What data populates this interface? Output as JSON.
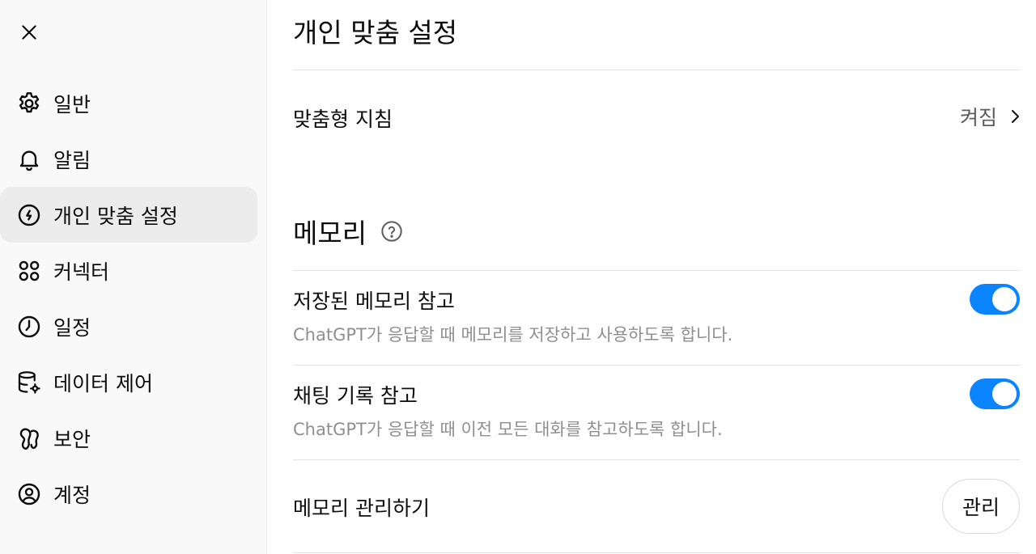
{
  "sidebar": {
    "close_icon": "close-icon",
    "items": [
      {
        "label": "일반",
        "icon": "gear-icon",
        "active": false
      },
      {
        "label": "알림",
        "icon": "bell-icon",
        "active": false
      },
      {
        "label": "개인 맞춤 설정",
        "icon": "personalization-icon",
        "active": true
      },
      {
        "label": "커넥터",
        "icon": "connectors-icon",
        "active": false
      },
      {
        "label": "일정",
        "icon": "clock-icon",
        "active": false
      },
      {
        "label": "데이터 제어",
        "icon": "database-gear-icon",
        "active": false
      },
      {
        "label": "보안",
        "icon": "security-icon",
        "active": false
      },
      {
        "label": "계정",
        "icon": "user-circle-icon",
        "active": false
      }
    ]
  },
  "main": {
    "title": "개인 맞춤 설정",
    "custom_instructions": {
      "label": "맞춤형 지침",
      "value": "켜짐"
    },
    "memory": {
      "title": "메모리",
      "saved_memory": {
        "label": "저장된 메모리 참고",
        "description": "ChatGPT가 응답할 때 메모리를 저장하고 사용하도록 합니다.",
        "enabled": true
      },
      "chat_history": {
        "label": "채팅 기록 참고",
        "description": "ChatGPT가 응답할 때 이전 모든 대화를 참고하도록 합니다.",
        "enabled": true
      },
      "manage": {
        "label": "메모리 관리하기",
        "button_label": "관리"
      }
    }
  },
  "colors": {
    "accent": "#0a84ff",
    "sidebar_bg": "#f9f9f9",
    "active_item_bg": "#ececec",
    "secondary_text": "#8f8f8f"
  }
}
